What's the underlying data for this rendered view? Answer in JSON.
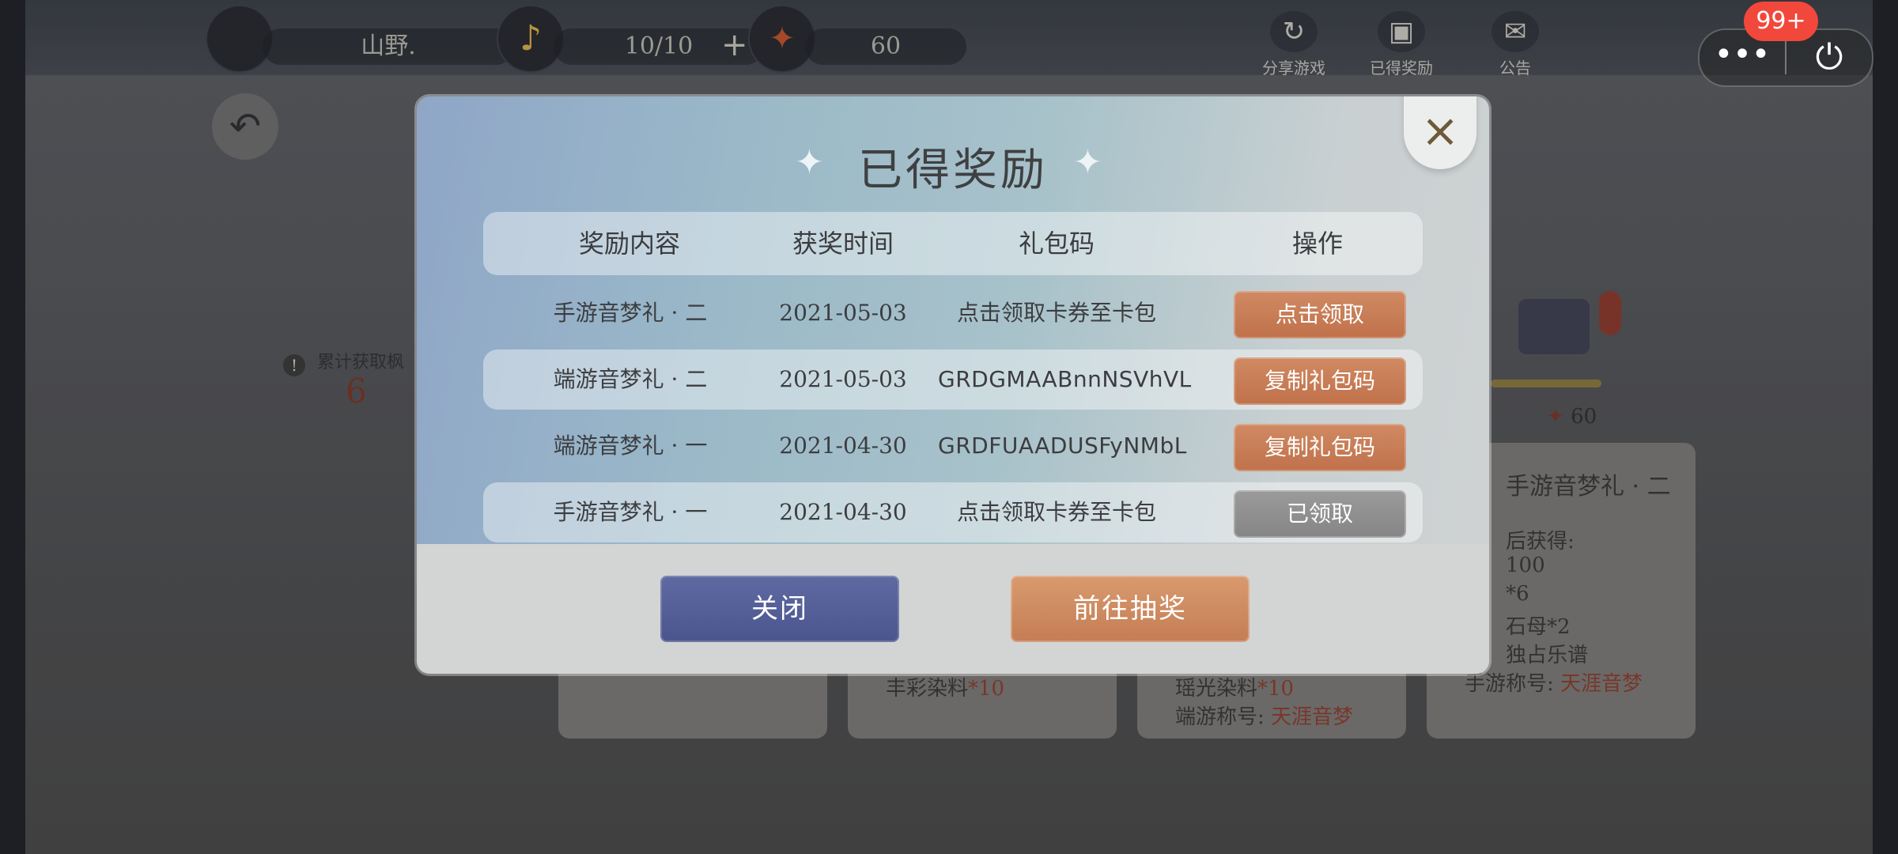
{
  "topbar": {
    "username": "山野.",
    "music_count": "10/10",
    "leaf_count": "60",
    "share_label": "分享游戏",
    "rewards_label": "已得奖励",
    "notice_label": "公告"
  },
  "wechat": {
    "badge": "99+"
  },
  "background": {
    "cumulative_label": "累计获取枫",
    "cumulative_value": "6",
    "chest_cost": "60",
    "card4_title": "手游音梦礼 · 二",
    "card4_obtain": "后获得:",
    "card4_l1": "100",
    "card4_l2": "*6",
    "card4_l3": "石母*2",
    "card4_l4": "独占乐谱",
    "card4_l5_label": "手游称号: ",
    "card4_l5_value": "天涯音梦",
    "card2_line": "丰彩染料",
    "card2_qty": "*10",
    "card3_line1": "瑶光染料",
    "card3_qty": "*10",
    "card3_line2_label": "端游称号: ",
    "card3_line2_value": "天涯音梦"
  },
  "dialog": {
    "title": "已得奖励",
    "headers": [
      "奖励内容",
      "获奖时间",
      "礼包码",
      "操作"
    ],
    "rows": [
      {
        "content": "手游音梦礼 · 二",
        "date": "2021-05-03",
        "code": "点击领取卡券至卡包",
        "action": "点击领取",
        "state": "active"
      },
      {
        "content": "端游音梦礼 · 二",
        "date": "2021-05-03",
        "code": "GRDGMAABnnNSVhVL",
        "action": "复制礼包码",
        "state": "active"
      },
      {
        "content": "端游音梦礼 · 一",
        "date": "2021-04-30",
        "code": "GRDFUAADUSFyNMbL",
        "action": "复制礼包码",
        "state": "active"
      },
      {
        "content": "手游音梦礼 · 一",
        "date": "2021-04-30",
        "code": "点击领取卡券至卡包",
        "action": "已领取",
        "state": "claimed"
      }
    ],
    "close_button": "关闭",
    "draw_button": "前往抽奖",
    "close_icon": "×"
  }
}
